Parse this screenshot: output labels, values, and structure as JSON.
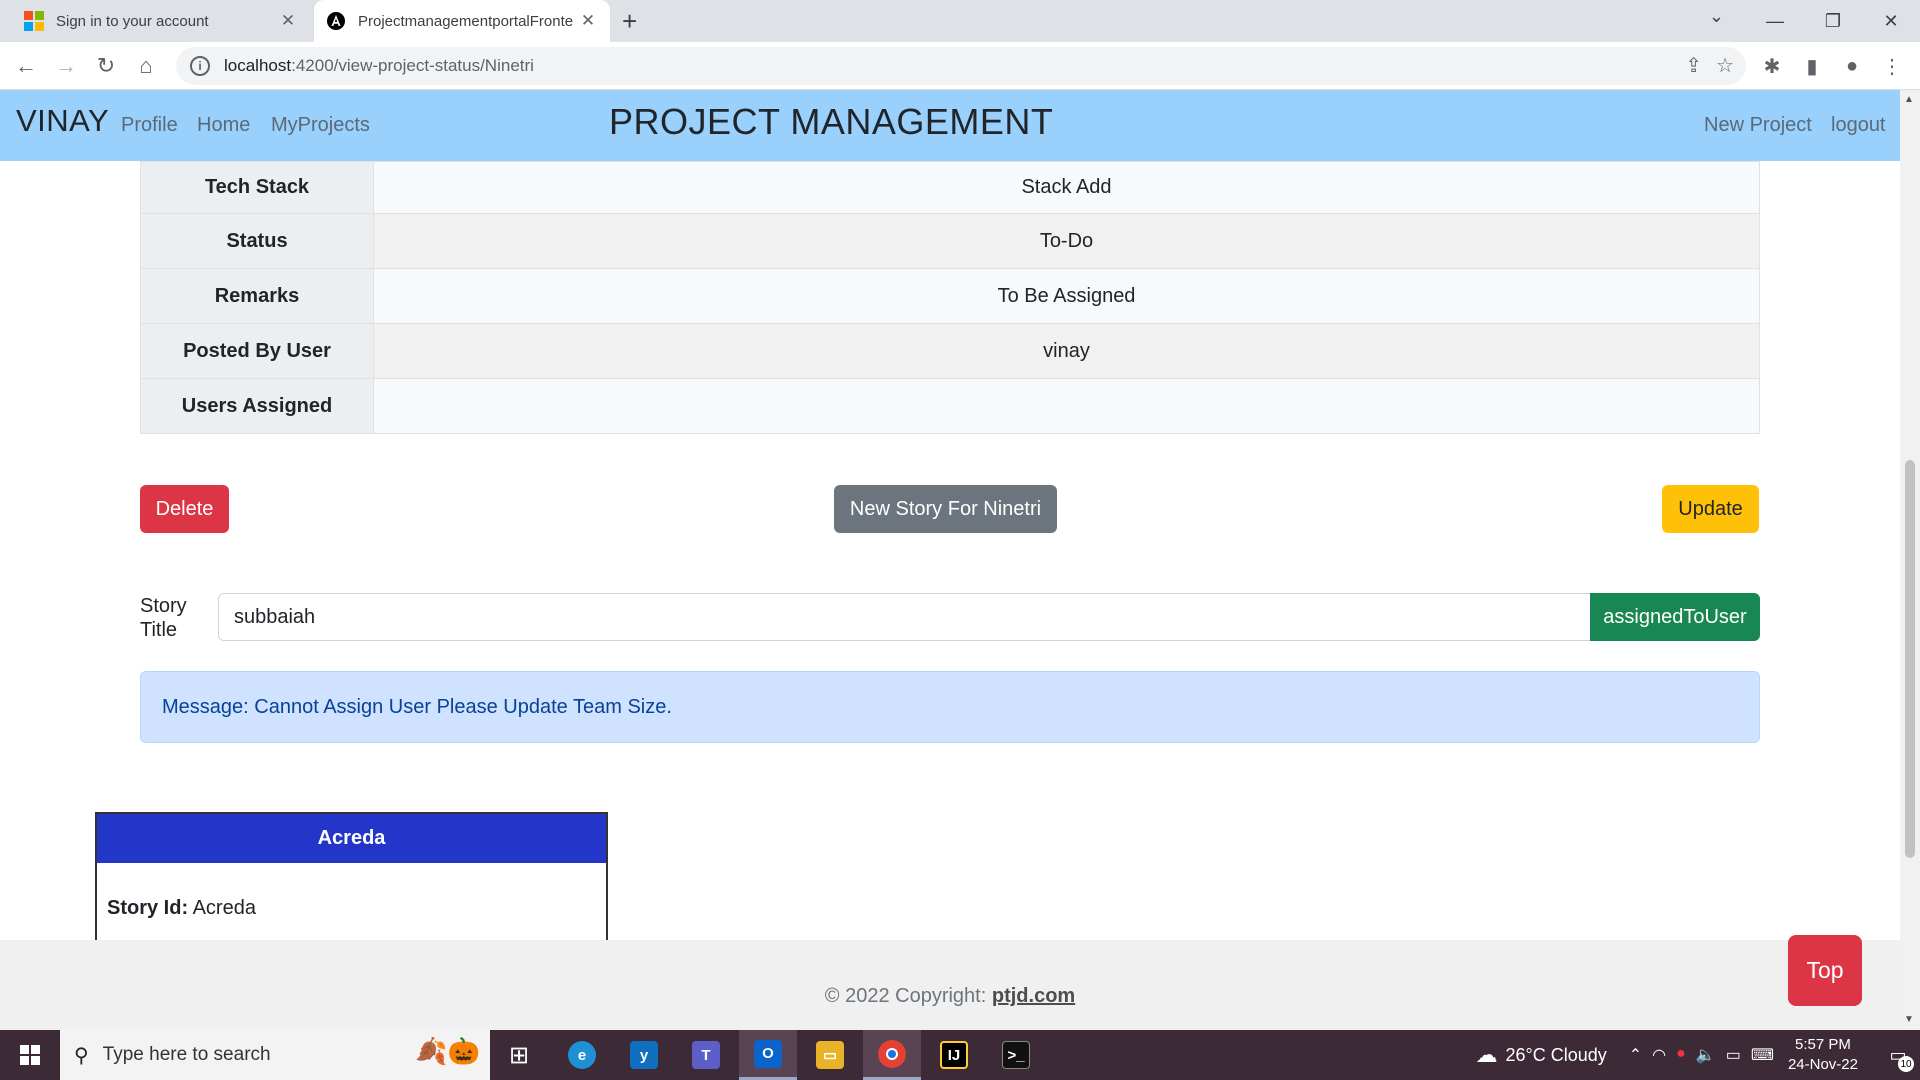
{
  "browser": {
    "tabs": [
      {
        "title": "Sign in to your account",
        "active": false,
        "icon": "microsoft-icon"
      },
      {
        "title": "ProjectmanagementportalFronte",
        "active": true,
        "icon": "angular-icon"
      }
    ],
    "url_host": "localhost",
    "url_path": ":4200/view-project-status/Ninetri"
  },
  "navbar": {
    "brand": "VINAY",
    "links": [
      "Profile",
      "Home",
      "MyProjects"
    ],
    "title": "PROJECT MANAGEMENT",
    "right_links": [
      "New Project",
      "logout"
    ]
  },
  "details": [
    {
      "label": "Tech Stack",
      "value": "Stack Add"
    },
    {
      "label": "Status",
      "value": "To-Do"
    },
    {
      "label": "Remarks",
      "value": "To Be Assigned"
    },
    {
      "label": "Posted By User",
      "value": "vinay"
    },
    {
      "label": "Users Assigned",
      "value": ""
    }
  ],
  "actions": {
    "delete": "Delete",
    "new_story": "New Story For Ninetri",
    "update": "Update"
  },
  "story_form": {
    "label_line1": "Story",
    "label_line2": "Title",
    "value": "subbaiah",
    "assign_button": "assignedToUser"
  },
  "alert": {
    "message": "Message: Cannot Assign User Please Update Team Size."
  },
  "story_card": {
    "header": "Acreda",
    "id_label": "Story Id:",
    "id_value": "Acreda"
  },
  "footer": {
    "copyright": "© 2022 Copyright: ",
    "link": "ptjd.com"
  },
  "top_button": "Top",
  "taskbar": {
    "search_placeholder": "Type here to search",
    "weather": "26°C  Cloudy",
    "time": "5:57 PM",
    "date": "24-Nov-22",
    "notification_count": "10"
  },
  "colors": {
    "navbar_bg": "#99d0fc",
    "delete": "#dc3545",
    "secondary": "#6c757d",
    "warning": "#ffc107",
    "success": "#198754",
    "alert_bg": "#cfe2ff",
    "card_header": "#2336c9"
  }
}
